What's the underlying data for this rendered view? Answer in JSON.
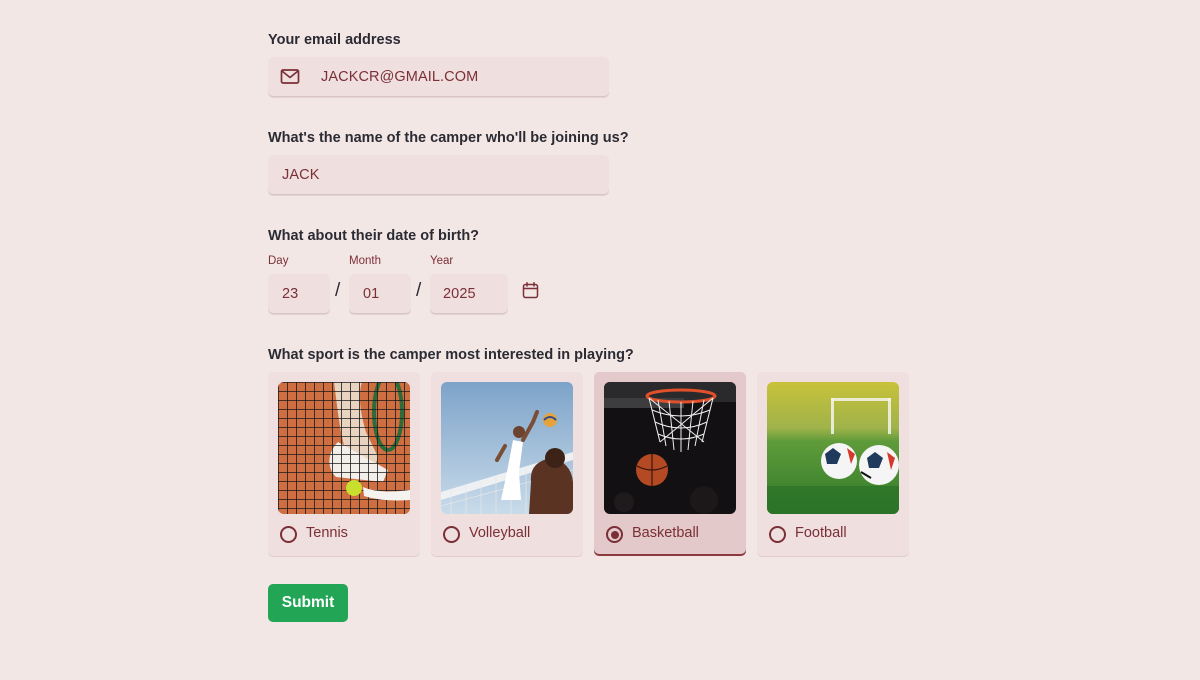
{
  "email": {
    "label": "Your email address",
    "value": "JACKCR@GMAIL.COM",
    "icon": "mail-icon"
  },
  "camper_name": {
    "label": "What's the name of the camper who'll be joining us?",
    "value": "JACK"
  },
  "dob": {
    "label": "What about their date of birth?",
    "day_label": "Day",
    "day_value": "23",
    "month_label": "Month",
    "month_value": "01",
    "year_label": "Year",
    "year_value": "2025",
    "separator": "/",
    "icon": "calendar-icon"
  },
  "sport": {
    "label": "What sport is the camper most interested in playing?",
    "selected": "Basketball",
    "options": [
      {
        "label": "Tennis",
        "image": "tennis-image"
      },
      {
        "label": "Volleyball",
        "image": "volleyball-image"
      },
      {
        "label": "Basketball",
        "image": "basketball-image"
      },
      {
        "label": "Football",
        "image": "football-image"
      }
    ]
  },
  "submit_label": "Submit",
  "colors": {
    "background": "#f3e7e6",
    "field": "#efdfdf",
    "accent": "#7b2f36",
    "selected_card": "#e3c9c9",
    "submit": "#22a655"
  }
}
